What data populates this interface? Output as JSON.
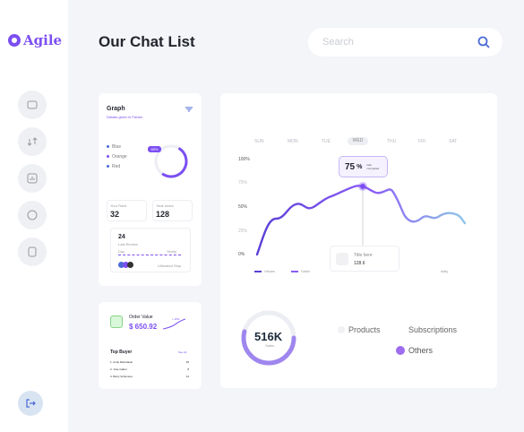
{
  "brand": {
    "name": "Agile",
    "accent": "#7c4ff2"
  },
  "header": {
    "title": "Our Chat List",
    "search_placeholder": "Search"
  },
  "nav": {
    "items": [
      "chat-icon",
      "transfer-icon",
      "analytics-icon",
      "message-icon",
      "document-icon"
    ],
    "logout": "logout-icon"
  },
  "graph_card": {
    "title": "Graph",
    "subtitle": "Details given in Param",
    "legend": [
      "Blue",
      "Orange",
      "Red"
    ],
    "badge": "80%",
    "stat1": {
      "label": "Your Rank",
      "value": "32"
    },
    "stat2": {
      "label": "Total views",
      "value": "128"
    },
    "mini": {
      "value": "24",
      "sub": "Last Review",
      "left": "Day",
      "right": "Yearly",
      "footer": "Ultimated Stop"
    }
  },
  "order_card": {
    "label": "Order Value",
    "value": "$ 650.92",
    "change": "+ 25%",
    "top_buyer": "Top Buyer",
    "see_all_label": "See All",
    "buyers": [
      {
        "name": "1. Andy Rebuttasin",
        "value": "25"
      },
      {
        "name": "2. Jose Gabel",
        "value": "8"
      },
      {
        "name": "3. Barry Schumere",
        "value": "14"
      }
    ]
  },
  "main_chart": {
    "days": [
      "SUN",
      "MON",
      "TUE",
      "WED",
      "THU",
      "FRI",
      "SAT"
    ],
    "y_labels": [
      "100%",
      "75%",
      "50%",
      "25%",
      "0%"
    ],
    "tooltip_value": "75",
    "tooltip_unit": "%",
    "tooltip_note": "task completed",
    "callout_title": "Title here",
    "callout_value": "128.6",
    "legend": [
      "Values",
      "Sales"
    ],
    "daily_label": "daily"
  },
  "sales": {
    "value": "516K",
    "label": "Sales",
    "categories": [
      "Products",
      "Subscriptions",
      "Others"
    ]
  },
  "chart_data": {
    "type": "line",
    "x": [
      "SUN",
      "MON",
      "TUE",
      "WED",
      "THU",
      "FRI",
      "SAT"
    ],
    "series": [
      {
        "values": [
          5,
          45,
          47,
          75,
          45,
          43,
          35
        ]
      }
    ],
    "ylim": [
      0,
      100
    ]
  }
}
